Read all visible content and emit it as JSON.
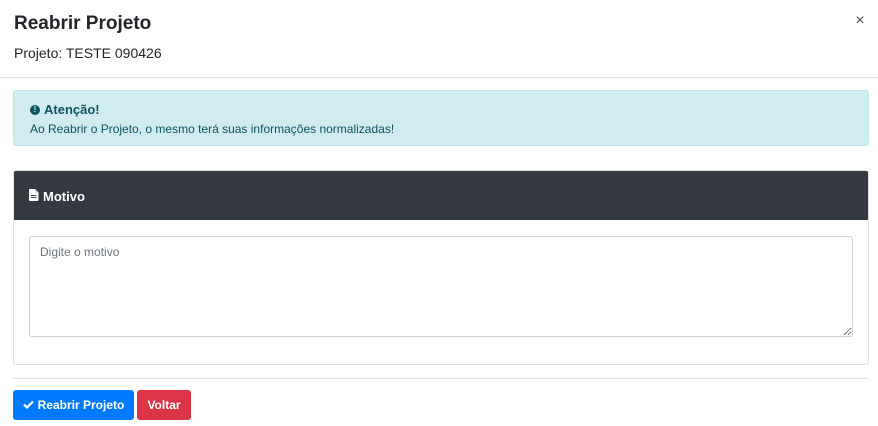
{
  "modal": {
    "title": "Reabrir Projeto",
    "subtitle": "Projeto: TESTE 090426",
    "close_label": "×"
  },
  "alert": {
    "heading": "Atenção!",
    "text": "Ao Reabrir o Projeto, o mesmo terá suas informações normalizadas!",
    "icon": "exclamation-circle-icon"
  },
  "motivo": {
    "title": "Motivo",
    "icon": "file-icon",
    "placeholder": "Digite o motivo",
    "value": ""
  },
  "actions": {
    "reopen_label": "Reabrir Projeto",
    "back_label": "Voltar"
  },
  "colors": {
    "primary": "#007bff",
    "danger": "#dc3545",
    "alert_bg": "#d1ecf1",
    "alert_text": "#0c5460",
    "card_header": "#343a40"
  }
}
